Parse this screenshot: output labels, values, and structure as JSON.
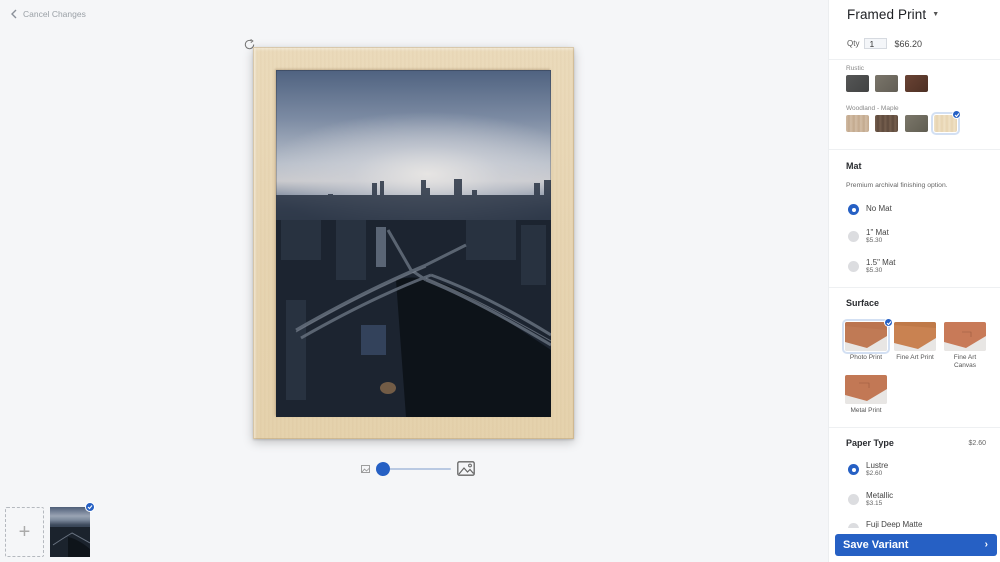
{
  "workspace": {
    "cancel_label": "Cancel Changes",
    "zoom_level_percent": 0,
    "thumbnail_selected": true
  },
  "panel": {
    "product_title": "Framed Print",
    "qty_label": "Qty",
    "qty_value": "1",
    "price": "$66.20",
    "frame_groups": [
      {
        "label": "Rustic",
        "swatches": [
          {
            "name": "rustic-charcoal",
            "color": "#4b4c4c",
            "selected": false
          },
          {
            "name": "rustic-gray",
            "color": "#6f6a60",
            "selected": false
          },
          {
            "name": "rustic-brown",
            "color": "#5a3a2c",
            "selected": false
          }
        ]
      },
      {
        "label": "Woodland - Maple",
        "swatches": [
          {
            "name": "woodland-natural",
            "color": "#c7ad92",
            "selected": false
          },
          {
            "name": "woodland-walnut",
            "color": "#6b5446",
            "selected": false
          },
          {
            "name": "woodland-driftwood",
            "color": "#6f6b5c",
            "selected": false
          },
          {
            "name": "woodland-maple",
            "color": "#ecdcbd",
            "selected": true
          }
        ]
      }
    ],
    "mat": {
      "title": "Mat",
      "description": "Premium archival finishing option.",
      "options": [
        {
          "label": "No Mat",
          "price": "",
          "selected": true
        },
        {
          "label": "1\" Mat",
          "price": "$5.30",
          "selected": false
        },
        {
          "label": "1.5\" Mat",
          "price": "$5.30",
          "selected": false
        }
      ]
    },
    "surface": {
      "title": "Surface",
      "options": [
        {
          "label": "Photo Print",
          "selected": true
        },
        {
          "label": "Fine Art Print",
          "selected": false
        },
        {
          "label": "Fine Art Canvas",
          "selected": false
        },
        {
          "label": "Metal Print",
          "selected": false
        }
      ]
    },
    "paper": {
      "title": "Paper Type",
      "price": "$2.60",
      "options": [
        {
          "label": "Lustre",
          "price": "$2.60",
          "selected": true
        },
        {
          "label": "Metallic",
          "price": "$3.15",
          "selected": false
        },
        {
          "label": "Fuji Deep Matte",
          "price": "",
          "selected": false
        }
      ]
    },
    "save_label": "Save Variant",
    "save_chevron": "›"
  },
  "colors": {
    "accent": "#2660c4",
    "frame_maple": "#ecdcbd",
    "background": "#f5f6f8"
  }
}
